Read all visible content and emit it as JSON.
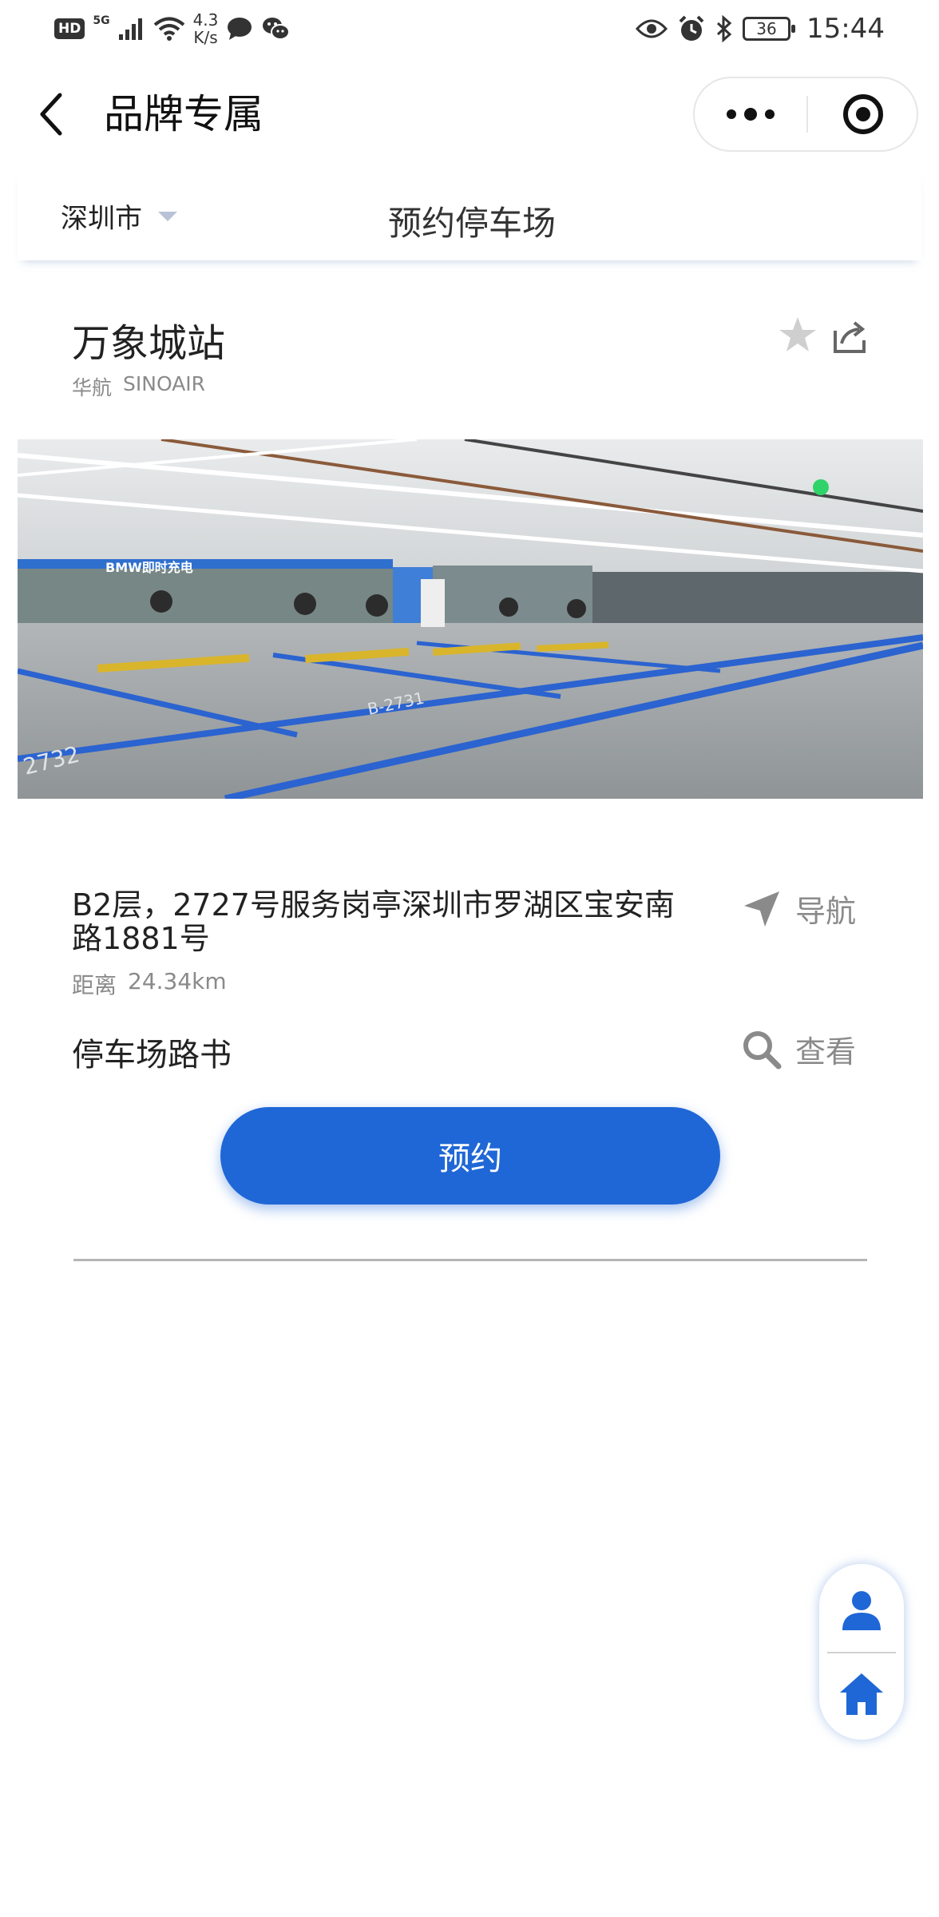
{
  "status_bar": {
    "hd": "HD",
    "network": "5G",
    "speed_value": "4.3",
    "speed_unit": "K/s",
    "battery": "36",
    "time": "15:44"
  },
  "nav": {
    "title": "品牌专属"
  },
  "subheader": {
    "city": "深圳市",
    "heading": "预约停车场"
  },
  "station": {
    "name": "万象城站",
    "brand_cn": "华航",
    "brand_en": "SINOAIR",
    "address": "B2层，2727号服务岗亭深圳市罗湖区宝安南路1881号",
    "distance_label": "距离",
    "distance_value": "24.34km",
    "navigate_label": "导航",
    "roadbook_label": "停车场路书",
    "view_label": "查看",
    "photo_sign": "BMW即时充电",
    "photo_spot_1": "2732",
    "photo_spot_2": "B-2731"
  },
  "actions": {
    "reserve_label": "预约"
  },
  "colors": {
    "accent": "#1f67d6",
    "muted": "#8a8a8a"
  },
  "icons": {
    "back": "chevron-left-icon",
    "more": "more-icon",
    "close": "target-icon",
    "dropdown": "triangle-down-icon",
    "favorite": "star-icon",
    "share": "share-icon",
    "navigate": "navigation-arrow-icon",
    "view": "search-icon",
    "user": "user-icon",
    "home": "home-icon"
  }
}
